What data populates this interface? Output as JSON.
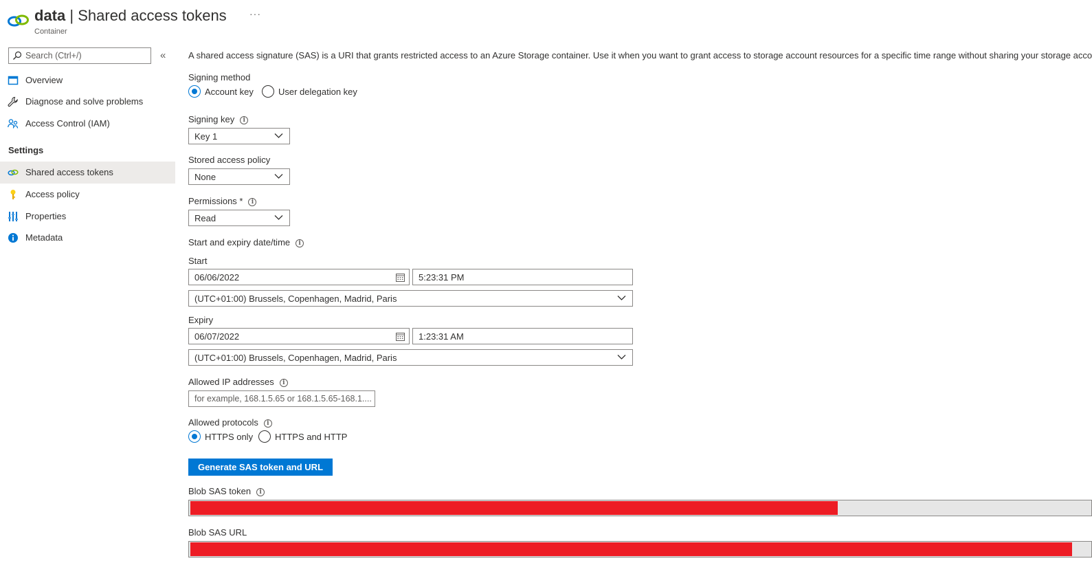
{
  "header": {
    "resource_name": "data",
    "separator": "|",
    "page_title": "Shared access tokens",
    "subtitle": "Container",
    "more_label": "···"
  },
  "sidebar": {
    "search_placeholder": "Search (Ctrl+/)",
    "collapse_label": "«",
    "items": [
      {
        "label": "Overview",
        "icon": "overview-icon"
      },
      {
        "label": "Diagnose and solve problems",
        "icon": "wrench-icon"
      },
      {
        "label": "Access Control (IAM)",
        "icon": "people-icon"
      }
    ],
    "settings_heading": "Settings",
    "settings_items": [
      {
        "label": "Shared access tokens",
        "icon": "link-icon",
        "active": true
      },
      {
        "label": "Access policy",
        "icon": "key-icon"
      },
      {
        "label": "Properties",
        "icon": "properties-icon"
      },
      {
        "label": "Metadata",
        "icon": "info-icon"
      }
    ]
  },
  "main": {
    "description": "A shared access signature (SAS) is a URI that grants restricted access to an Azure Storage container. Use it when you want to grant access to storage account resources for a specific time range without sharing your storage account",
    "signing_method": {
      "label": "Signing method",
      "options": [
        "Account key",
        "User delegation key"
      ],
      "selected": "Account key"
    },
    "signing_key": {
      "label": "Signing key",
      "value": "Key 1"
    },
    "stored_access_policy": {
      "label": "Stored access policy",
      "value": "None"
    },
    "permissions": {
      "label": "Permissions",
      "required_mark": "*",
      "value": "Read"
    },
    "datetime_heading": "Start and expiry date/time",
    "start": {
      "label": "Start",
      "date": "06/06/2022",
      "time": "5:23:31 PM",
      "timezone": "(UTC+01:00) Brussels, Copenhagen, Madrid, Paris"
    },
    "expiry": {
      "label": "Expiry",
      "date": "06/07/2022",
      "time": "1:23:31 AM",
      "timezone": "(UTC+01:00) Brussels, Copenhagen, Madrid, Paris"
    },
    "allowed_ip": {
      "label": "Allowed IP addresses",
      "placeholder": "for example, 168.1.5.65 or 168.1.5.65-168.1...."
    },
    "allowed_protocols": {
      "label": "Allowed protocols",
      "options": [
        "HTTPS only",
        "HTTPS and HTTP"
      ],
      "selected": "HTTPS only"
    },
    "generate_button": "Generate SAS token and URL",
    "blob_sas_token": {
      "label": "Blob SAS token",
      "redacted_fraction": 0.72
    },
    "blob_sas_url": {
      "label": "Blob SAS URL",
      "redacted_fraction": 0.98
    }
  },
  "colors": {
    "accent": "#0078d4",
    "redaction": "#ed1c24",
    "active_nav_bg": "#edebe9"
  }
}
